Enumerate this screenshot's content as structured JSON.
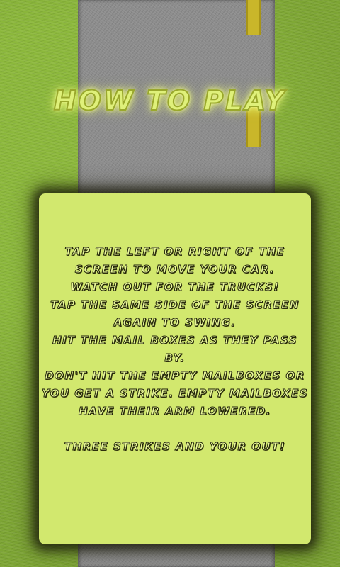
{
  "title": "HOW TO PLAY",
  "instructions": {
    "lines": [
      "TAP THE LEFT OR RIGHT OF THE",
      "SCREEN TO MOVE YOUR CAR.",
      "WATCH OUT FOR THE TRUCKS!",
      "TAP THE SAME SIDE OF THE SCREEN",
      "AGAIN TO SWING.",
      "HIT THE  MAIL BOXES AS THEY PASS",
      "BY.",
      "DON'T HIT THE EMPTY MAILBOXES OR",
      "YOU GET A STRIKE. EMPTY MAILBOXES",
      "HAVE THEIR ARM LOWERED.",
      "",
      "THREE STRIKES AND YOUR OUT!"
    ]
  },
  "colors": {
    "grass": "#7da534",
    "road": "#8d8d8d",
    "lane_line": "#c9b62a",
    "panel": "#d2e86e",
    "title_glow": "#dff07a"
  }
}
